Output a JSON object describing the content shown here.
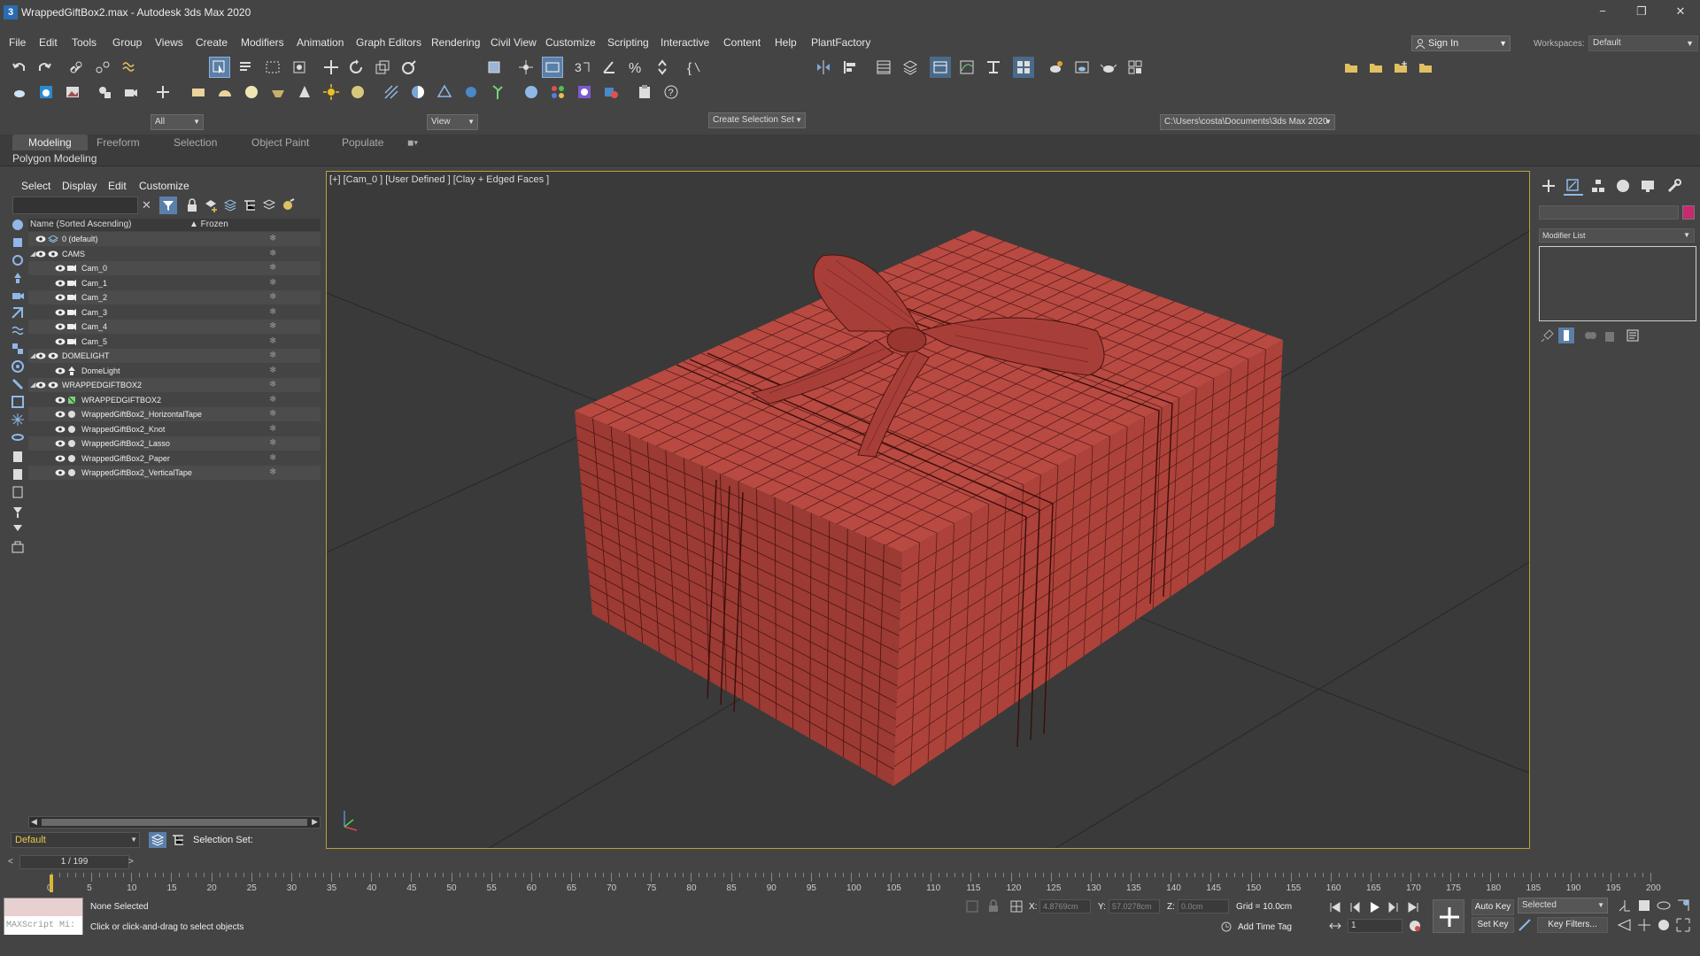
{
  "titlebar": {
    "app_icon": "3",
    "title": "WrappedGiftBox2.max - Autodesk 3ds Max 2020",
    "minimize": "−",
    "restore": "❐",
    "close": "✕"
  },
  "menubar": [
    "File",
    "Edit",
    "Tools",
    "Group",
    "Views",
    "Create",
    "Modifiers",
    "Animation",
    "Graph Editors",
    "Rendering",
    "Civil View",
    "Customize",
    "Scripting",
    "Interactive",
    "Content",
    "Help",
    "PlantFactory"
  ],
  "signin": {
    "label": "Sign In"
  },
  "workspace": {
    "label": "Workspaces:",
    "value": "Default"
  },
  "toolbar": {
    "selection_filter": "All",
    "ref_coord": "View",
    "selection_set": "Create Selection Set",
    "project_path": "C:\\Users\\costa\\Documents\\3ds Max 2020"
  },
  "ribbon": {
    "tabs": [
      "Modeling",
      "Freeform",
      "Selection",
      "Object Paint",
      "Populate"
    ],
    "active_tab": "Modeling",
    "subpanel": "Polygon Modeling"
  },
  "scene_explorer": {
    "menu": [
      "Select",
      "Display",
      "Edit",
      "Customize"
    ],
    "columns": {
      "name": "Name (Sorted Ascending)",
      "frozen": "▲ Frozen"
    },
    "rows": [
      {
        "label": "0 (default)",
        "indent": 0,
        "type": "layer",
        "expanded": null
      },
      {
        "label": "CAMS",
        "indent": 0,
        "type": "group",
        "expanded": true
      },
      {
        "label": "Cam_0",
        "indent": 1,
        "type": "camera"
      },
      {
        "label": "Cam_1",
        "indent": 1,
        "type": "camera"
      },
      {
        "label": "Cam_2",
        "indent": 1,
        "type": "camera"
      },
      {
        "label": "Cam_3",
        "indent": 1,
        "type": "camera"
      },
      {
        "label": "Cam_4",
        "indent": 1,
        "type": "camera"
      },
      {
        "label": "Cam_5",
        "indent": 1,
        "type": "camera"
      },
      {
        "label": "DOMELIGHT",
        "indent": 0,
        "type": "group",
        "expanded": true
      },
      {
        "label": "DomeLight",
        "indent": 1,
        "type": "light"
      },
      {
        "label": "WRAPPEDGIFTBOX2",
        "indent": 0,
        "type": "group",
        "expanded": true
      },
      {
        "label": "WRAPPEDGIFTBOX2",
        "indent": 1,
        "type": "helper"
      },
      {
        "label": "WrappedGiftBox2_HorizontalTape",
        "indent": 1,
        "type": "mesh"
      },
      {
        "label": "WrappedGiftBox2_Knot",
        "indent": 1,
        "type": "mesh"
      },
      {
        "label": "WrappedGiftBox2_Lasso",
        "indent": 1,
        "type": "mesh"
      },
      {
        "label": "WrappedGiftBox2_Paper",
        "indent": 1,
        "type": "mesh"
      },
      {
        "label": "WrappedGiftBox2_VerticalTape",
        "indent": 1,
        "type": "mesh"
      }
    ],
    "layer_dropdown": "Default",
    "selection_set_label": "Selection Set:"
  },
  "viewport": {
    "label": "[+] [Cam_0 ] [User Defined ] [Clay + Edged Faces ]"
  },
  "command_panel": {
    "modifier_list": "Modifier List",
    "color": "#c8286e"
  },
  "timeline": {
    "frame_display": "1 / 199",
    "prev": "<",
    "next": ">",
    "ruler_labels": [
      "0",
      "5",
      "10",
      "15",
      "20",
      "25",
      "30",
      "35",
      "40",
      "45",
      "50",
      "55",
      "60",
      "65",
      "70",
      "75",
      "80",
      "85",
      "90",
      "95",
      "100",
      "105",
      "110",
      "115",
      "120",
      "125",
      "130",
      "135",
      "140",
      "145",
      "150",
      "155",
      "160",
      "165",
      "170",
      "175",
      "180",
      "185",
      "190",
      "195",
      "200"
    ]
  },
  "status": {
    "maxscript": "MAXScript Mi:",
    "selection": "None Selected",
    "prompt": "Click or click-and-drag to select objects",
    "x_label": "X:",
    "x_value": "4.8769cm",
    "y_label": "Y:",
    "y_value": "57.0278cm",
    "z_label": "Z:",
    "z_value": "0.0cm",
    "grid": "Grid = 10.0cm",
    "add_time_tag": "Add Time Tag",
    "auto_key": "Auto Key",
    "set_key": "Set Key",
    "key_mode": "Selected",
    "key_filters": "Key Filters...",
    "frame": "1"
  },
  "colors": {
    "box": "#b84a42",
    "wire": "#5a1c18",
    "viewport_bg": "#3a3a3a",
    "accent": "#b8a23a"
  }
}
